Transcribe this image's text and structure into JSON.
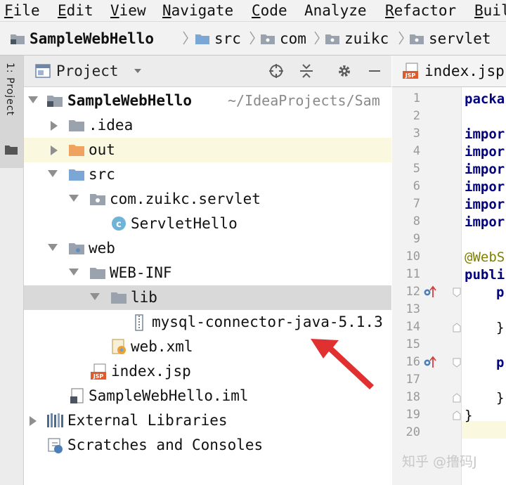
{
  "menu": [
    {
      "mnemonic": "F",
      "rest": "ile"
    },
    {
      "mnemonic": "E",
      "rest": "dit"
    },
    {
      "mnemonic": "V",
      "rest": "iew"
    },
    {
      "mnemonic": "N",
      "rest": "avigate"
    },
    {
      "mnemonic": "C",
      "rest": "ode"
    },
    {
      "mnemonic": "",
      "rest": "Analyze"
    },
    {
      "mnemonic": "R",
      "rest": "efactor"
    },
    {
      "mnemonic": "B",
      "rest": "uil"
    }
  ],
  "breadcrumb": [
    "SampleWebHello",
    "src",
    "com",
    "zuikc",
    "servlet"
  ],
  "left_strip": {
    "tab_label": "1: Project"
  },
  "project_panel": {
    "title": "Project"
  },
  "tree": {
    "root_label": "SampleWebHello",
    "root_path": "~/IdeaProjects/Sam",
    "idea": ".idea",
    "out": "out",
    "src": "src",
    "package": "com.zuikc.servlet",
    "class_file": "ServletHello",
    "web": "web",
    "web_inf": "WEB-INF",
    "lib": "lib",
    "jar": "mysql-connector-java-5.1.3",
    "web_xml": "web.xml",
    "index_jsp": "index.jsp",
    "iml": "SampleWebHello.iml",
    "external_libraries": "External Libraries",
    "scratches": "Scratches and Consoles"
  },
  "editor": {
    "tab_label": "index.jsp",
    "line_numbers": [
      "1",
      "2",
      "3",
      "4",
      "5",
      "6",
      "7",
      "8",
      "9",
      "10",
      "11",
      "12",
      "13",
      "14",
      "15",
      "16",
      "17",
      "18",
      "19",
      "20"
    ],
    "lines": {
      "l1": "packa",
      "l3": "impor",
      "l4": "impor",
      "l5": "impor",
      "l6": "impor",
      "l7": "impor",
      "l8": "impor",
      "l10": "@WebS",
      "l11": "publi",
      "l12": "p",
      "l14": "}",
      "l16": "p",
      "l18": "}",
      "l19": "}"
    }
  },
  "watermark": "知乎 @撸码J",
  "colors": {
    "folder_blue": "#7aa7d6",
    "folder_gray": "#9aa3ad",
    "folder_orange": "#f0a35e",
    "keyword": "#000080",
    "annotation": "#808000",
    "arrow_red": "#e03030"
  }
}
